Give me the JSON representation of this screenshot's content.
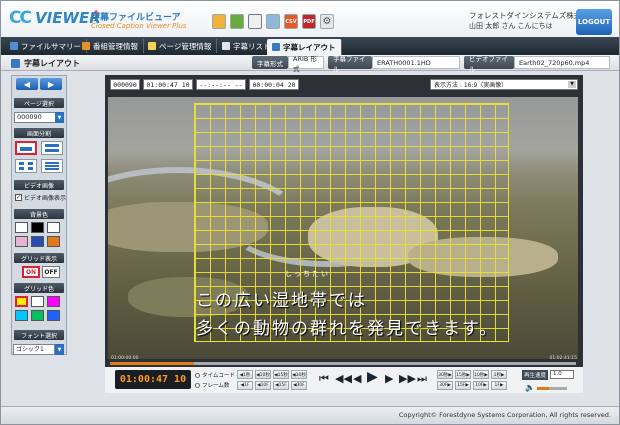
{
  "app": {
    "logo_cc": "CC",
    "logo_viewer": "VIEWER",
    "title": "字幕ファイルビューア",
    "subtitle": "Closed Caption Viewer Plus",
    "company": "フォレストダインシステムズ株式会社",
    "user": "山田 太郎 さん こんにちは",
    "logout": "LOGOUT"
  },
  "toolbar_icons": [
    "folder-icon",
    "table-icon",
    "document-icon",
    "picture-icon",
    "csv-icon",
    "pdf-icon",
    "gear-icon"
  ],
  "toolbar_icon_text": {
    "csv": "CSV",
    "pdf": "PDF"
  },
  "nav": {
    "items": [
      {
        "label": "ファイルサマリー"
      },
      {
        "label": "番組管理情報"
      },
      {
        "label": "ページ管理情報"
      },
      {
        "label": "字幕リスト"
      },
      {
        "label": "字幕レイアウト"
      }
    ]
  },
  "subbar": {
    "page_title": "字幕レイアウト",
    "format_label": "字幕形式",
    "format_value": "ARIB 形式",
    "file_label": "字幕ファイル",
    "file_value": "ERATH0001.1HD",
    "video_label": "ビデオファイル",
    "video_value": "Earth02_720p60.mp4"
  },
  "sidebar": {
    "prev": "◀",
    "next": "▶",
    "page_select_label": "ページ選択",
    "page_value": "000090",
    "split_label": "画面分割",
    "video_label": "ビデオ画像",
    "video_checkbox": "ビデオ画像表示",
    "bg_label": "背景色",
    "grid_show_label": "グリッド表示",
    "on": "ON",
    "off": "OFF",
    "grid_color_label": "グリッド色",
    "font_label": "フォント選択",
    "font_value": "ゴシック1"
  },
  "colors": {
    "bg_swatches": [
      "#ffffff",
      "#000000",
      "#ffffff",
      "#e8b4d4",
      "#2a4bb0",
      "#e07a1a",
      "#1a7a2a"
    ],
    "grid_swatches": [
      "#ffee00",
      "#ffffff",
      "#ff00ff",
      "#00c8ff",
      "#00c060",
      "#2060ff",
      "#ff00ff"
    ],
    "accent": "#2a6fc0",
    "seek": "#e07a1a"
  },
  "main": {
    "page_no": "000090",
    "tc_in": "01:00:47 10",
    "tc_blank": "--:--:-- --",
    "tc_duration": "00:00:04 20",
    "display_label": "表示方法 : 16:9（実画像）",
    "ruby": "しっちたい",
    "caption_line1": "この広い湿地帯では",
    "caption_line2": "多くの動物の群れを発見できます。",
    "time_start": "01:00:00:00",
    "time_end": "01:02:41:15",
    "current_tc": "01:00:47 10",
    "mode_timecode": "タイムコード",
    "mode_frame": "フレーム数",
    "back_jumps_top": [
      "◀1秒",
      "◀10秒",
      "◀15秒",
      "◀30秒"
    ],
    "back_jumps_bottom": [
      "◀1F",
      "◀10F",
      "◀15F",
      "◀30F"
    ],
    "fwd_jumps_top": [
      "30秒▶",
      "15秒▶",
      "10秒▶",
      "1秒▶"
    ],
    "fwd_jumps_bottom": [
      "30F▶",
      "15F▶",
      "10F▶",
      "1F▶"
    ],
    "transport": [
      "⏮",
      "◀◀",
      "◀",
      "▶",
      "▶",
      "▶▶",
      "⏭"
    ],
    "speed_label": "再生速度",
    "speed_value": "1.0",
    "seek_progress": 0.18,
    "volume": 0.4
  },
  "footer": {
    "copyright": "Copyright© Forestdyne Systems Corporation, All rights reserved."
  }
}
